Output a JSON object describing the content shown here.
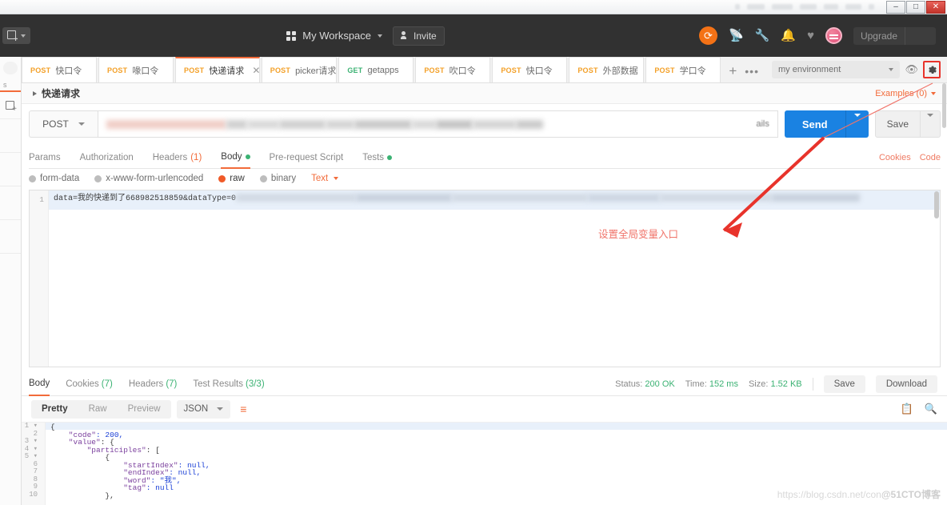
{
  "window": {
    "minimize_label": "–",
    "maximize_label": "□",
    "close_label": "✕"
  },
  "header": {
    "new_button_label": "New",
    "workspace_label": "My Workspace",
    "invite_label": "Invite",
    "upgrade_label": "Upgrade",
    "icons": {
      "sync": "sync-icon",
      "satellite": "satellite-icon",
      "wrench": "wrench-icon",
      "bell": "bell-icon",
      "heart": "heart-icon",
      "avatar": "user-avatar"
    }
  },
  "rail": {
    "label": "s",
    "new_icon": "new-tab-icon"
  },
  "tabs": [
    {
      "method": "POST",
      "name": "快口令",
      "active": false,
      "closable": false
    },
    {
      "method": "POST",
      "name": "喙口令",
      "active": false,
      "closable": false
    },
    {
      "method": "POST",
      "name": "快递请求",
      "active": true,
      "closable": true
    },
    {
      "method": "POST",
      "name": "picker请求",
      "active": false,
      "closable": false
    },
    {
      "method": "GET",
      "name": "getapps",
      "active": false,
      "closable": false
    },
    {
      "method": "POST",
      "name": "吹口令",
      "active": false,
      "closable": false
    },
    {
      "method": "POST",
      "name": "快口令",
      "active": false,
      "closable": false
    },
    {
      "method": "POST",
      "name": "外部数据",
      "active": false,
      "closable": false
    },
    {
      "method": "POST",
      "name": "学口令",
      "active": false,
      "closable": false
    }
  ],
  "tabstrip": {
    "add_label": "+",
    "more_label": "•••"
  },
  "environment": {
    "selected": "my environment",
    "eye_icon": "eye-icon",
    "gear_icon": "gear-icon",
    "highlight_color": "#e8332b"
  },
  "breadcrumb": {
    "title": "快递请求",
    "examples_label": "Examples (0)"
  },
  "request": {
    "method": "POST",
    "url_visible_tail": "ails",
    "url_redacted": true,
    "send_label": "Send",
    "save_label": "Save"
  },
  "request_tabs": [
    {
      "label": "Params",
      "active": false,
      "count": "",
      "dot": false
    },
    {
      "label": "Authorization",
      "active": false,
      "count": "",
      "dot": false
    },
    {
      "label": "Headers",
      "active": false,
      "count": "(1)",
      "dot": false
    },
    {
      "label": "Body",
      "active": true,
      "count": "",
      "dot": true
    },
    {
      "label": "Pre-request Script",
      "active": false,
      "count": "",
      "dot": false
    },
    {
      "label": "Tests",
      "active": false,
      "count": "",
      "dot": true
    }
  ],
  "request_tabs_right": [
    "Cookies",
    "Code"
  ],
  "body_types": [
    {
      "label": "form-data",
      "selected": false
    },
    {
      "label": "x-www-form-urlencoded",
      "selected": false
    },
    {
      "label": "raw",
      "selected": true
    },
    {
      "label": "binary",
      "selected": false
    }
  ],
  "body_format": "Text",
  "body_editor": {
    "line_number": "1",
    "content": "data=我的快递到了668982518859&dataType=0",
    "redacted": true
  },
  "response_tabs": [
    {
      "label": "Body",
      "count": "",
      "active": true
    },
    {
      "label": "Cookies",
      "count": "(7)",
      "active": false
    },
    {
      "label": "Headers",
      "count": "(7)",
      "active": false
    },
    {
      "label": "Test Results",
      "count": "(3/3)",
      "active": false
    }
  ],
  "response_meta": {
    "status_label": "Status:",
    "status_value": "200 OK",
    "time_label": "Time:",
    "time_value": "152 ms",
    "size_label": "Size:",
    "size_value": "1.52 KB",
    "save_label": "Save",
    "download_label": "Download"
  },
  "response_toolbar": {
    "views": [
      {
        "label": "Pretty",
        "active": true
      },
      {
        "label": "Raw",
        "active": false
      },
      {
        "label": "Preview",
        "active": false
      }
    ],
    "format": "JSON",
    "wrap_icon": "word-wrap-icon",
    "copy_icon": "copy-icon",
    "search_icon": "search-icon"
  },
  "response_body": {
    "lines": [
      {
        "n": "1",
        "fold": true,
        "text": "{"
      },
      {
        "n": "2",
        "fold": false,
        "text": "    \"code\": 200,"
      },
      {
        "n": "3",
        "fold": true,
        "text": "    \"value\": {"
      },
      {
        "n": "4",
        "fold": true,
        "text": "        \"participles\": ["
      },
      {
        "n": "5",
        "fold": true,
        "text": "            {"
      },
      {
        "n": "6",
        "fold": false,
        "text": "                \"startIndex\": null,"
      },
      {
        "n": "7",
        "fold": false,
        "text": "                \"endIndex\": null,"
      },
      {
        "n": "8",
        "fold": false,
        "text": "                \"word\": \"我\","
      },
      {
        "n": "9",
        "fold": false,
        "text": "                \"tag\": null"
      },
      {
        "n": "10",
        "fold": false,
        "text": "            },"
      }
    ]
  },
  "annotation": {
    "text": "设置全局变量入口",
    "color": "#f0756b"
  },
  "watermark": {
    "url": "https://blog.csdn.net/con",
    "tag": "@51CTO博客"
  }
}
